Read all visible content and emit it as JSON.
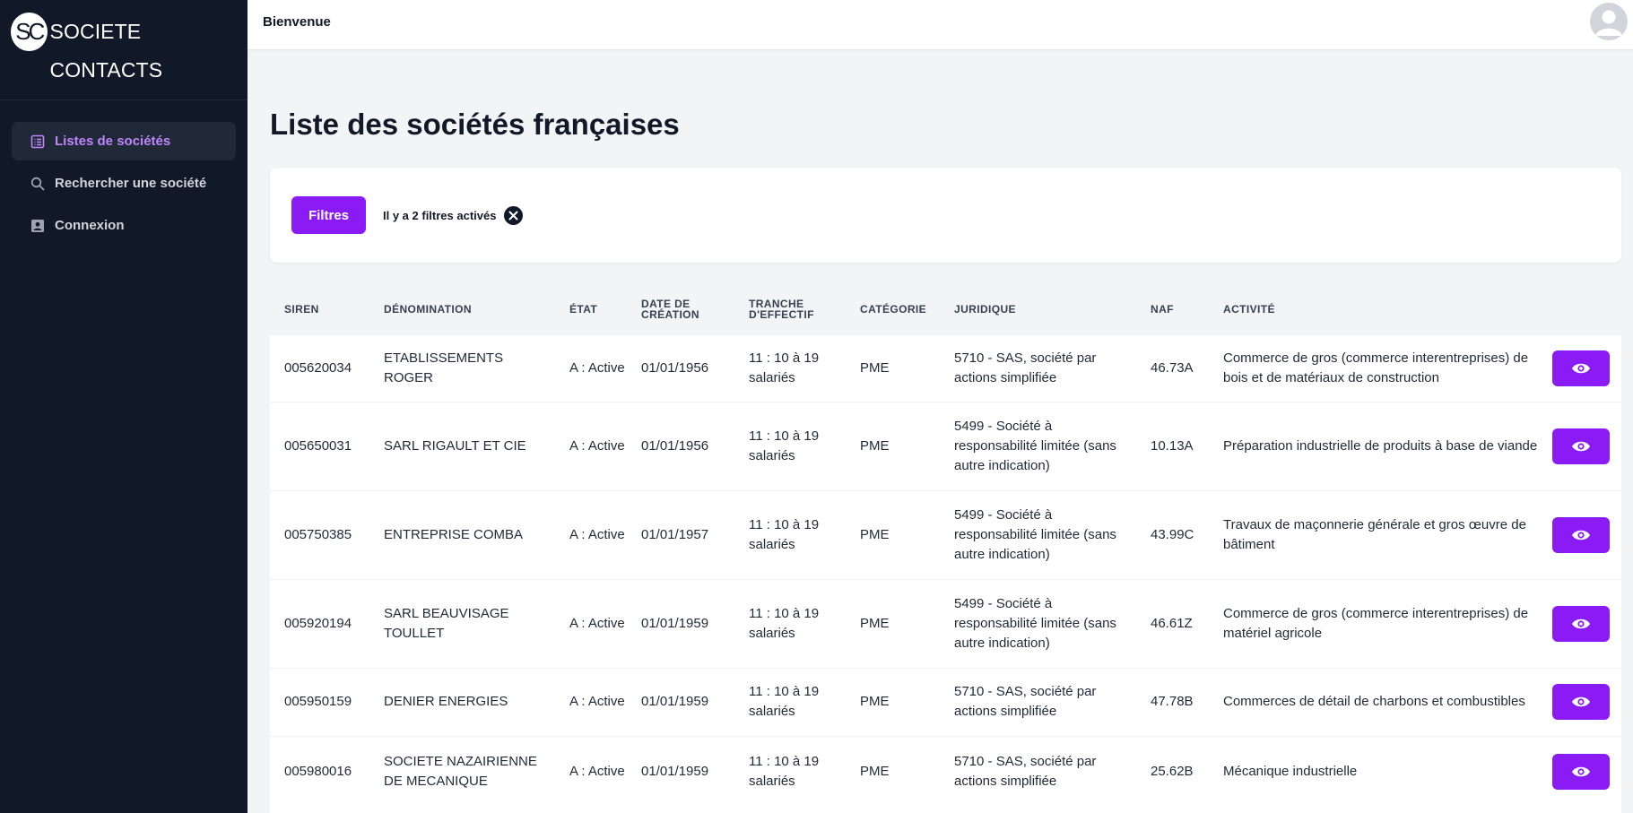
{
  "brand": {
    "logo": "SC",
    "name": "SOCIETE CONTACTS"
  },
  "sidebar": {
    "items": [
      {
        "label": "Listes de sociétés",
        "icon": "list-icon",
        "active": true
      },
      {
        "label": "Rechercher une société",
        "icon": "search-icon",
        "active": false
      },
      {
        "label": "Connexion",
        "icon": "contact-card-icon",
        "active": false
      }
    ]
  },
  "topbar": {
    "welcome": "Bienvenue",
    "avatar_icon": "user-avatar-icon"
  },
  "page": {
    "title": "Liste des sociétés françaises"
  },
  "filters": {
    "button_label": "Filtres",
    "status": "Il y a 2 filtres activés",
    "clear_icon": "close-circle-icon"
  },
  "colors": {
    "accent": "#8b1bf5",
    "sidebar_bg": "#111827",
    "active_text": "#c084fc"
  },
  "table": {
    "headers": [
      "SIREN",
      "DÉNOMINATION",
      "ÉTAT",
      "DATE DE CRÉATION",
      "TRANCHE D'EFFECTIF",
      "CATÉGORIE",
      "JURIDIQUE",
      "NAF",
      "ACTIVITÉ"
    ],
    "rows": [
      [
        "005620034",
        "ETABLISSEMENTS ROGER",
        "A : Active",
        "01/01/1956",
        "11 : 10 à 19 salariés",
        "PME",
        "5710 - SAS, société par actions simplifiée",
        "46.73A",
        "Commerce de gros (commerce interentreprises) de bois et de matériaux de construction"
      ],
      [
        "005650031",
        "SARL RIGAULT ET CIE",
        "A : Active",
        "01/01/1956",
        "11 : 10 à 19 salariés",
        "PME",
        "5499 - Société à responsabilité limitée (sans autre indication)",
        "10.13A",
        "Préparation industrielle de produits à base de viande"
      ],
      [
        "005750385",
        "ENTREPRISE COMBA",
        "A : Active",
        "01/01/1957",
        "11 : 10 à 19 salariés",
        "PME",
        "5499 - Société à responsabilité limitée (sans autre indication)",
        "43.99C",
        "Travaux de maçonnerie générale et gros œuvre de bâtiment"
      ],
      [
        "005920194",
        "SARL BEAUVISAGE TOULLET",
        "A : Active",
        "01/01/1959",
        "11 : 10 à 19 salariés",
        "PME",
        "5499 - Société à responsabilité limitée (sans autre indication)",
        "46.61Z",
        "Commerce de gros (commerce interentreprises) de matériel agricole"
      ],
      [
        "005950159",
        "DENIER ENERGIES",
        "A : Active",
        "01/01/1959",
        "11 : 10 à 19 salariés",
        "PME",
        "5710 - SAS, société par actions simplifiée",
        "47.78B",
        "Commerces de détail de charbons et combustibles"
      ],
      [
        "005980016",
        "SOCIETE NAZAIRIENNE DE MECANIQUE",
        "A : Active",
        "01/01/1959",
        "11 : 10 à 19 salariés",
        "PME",
        "5710 - SAS, société par actions simplifiée",
        "25.62B",
        "Mécanique industrielle"
      ]
    ],
    "row_action_icon": "eye-icon"
  }
}
